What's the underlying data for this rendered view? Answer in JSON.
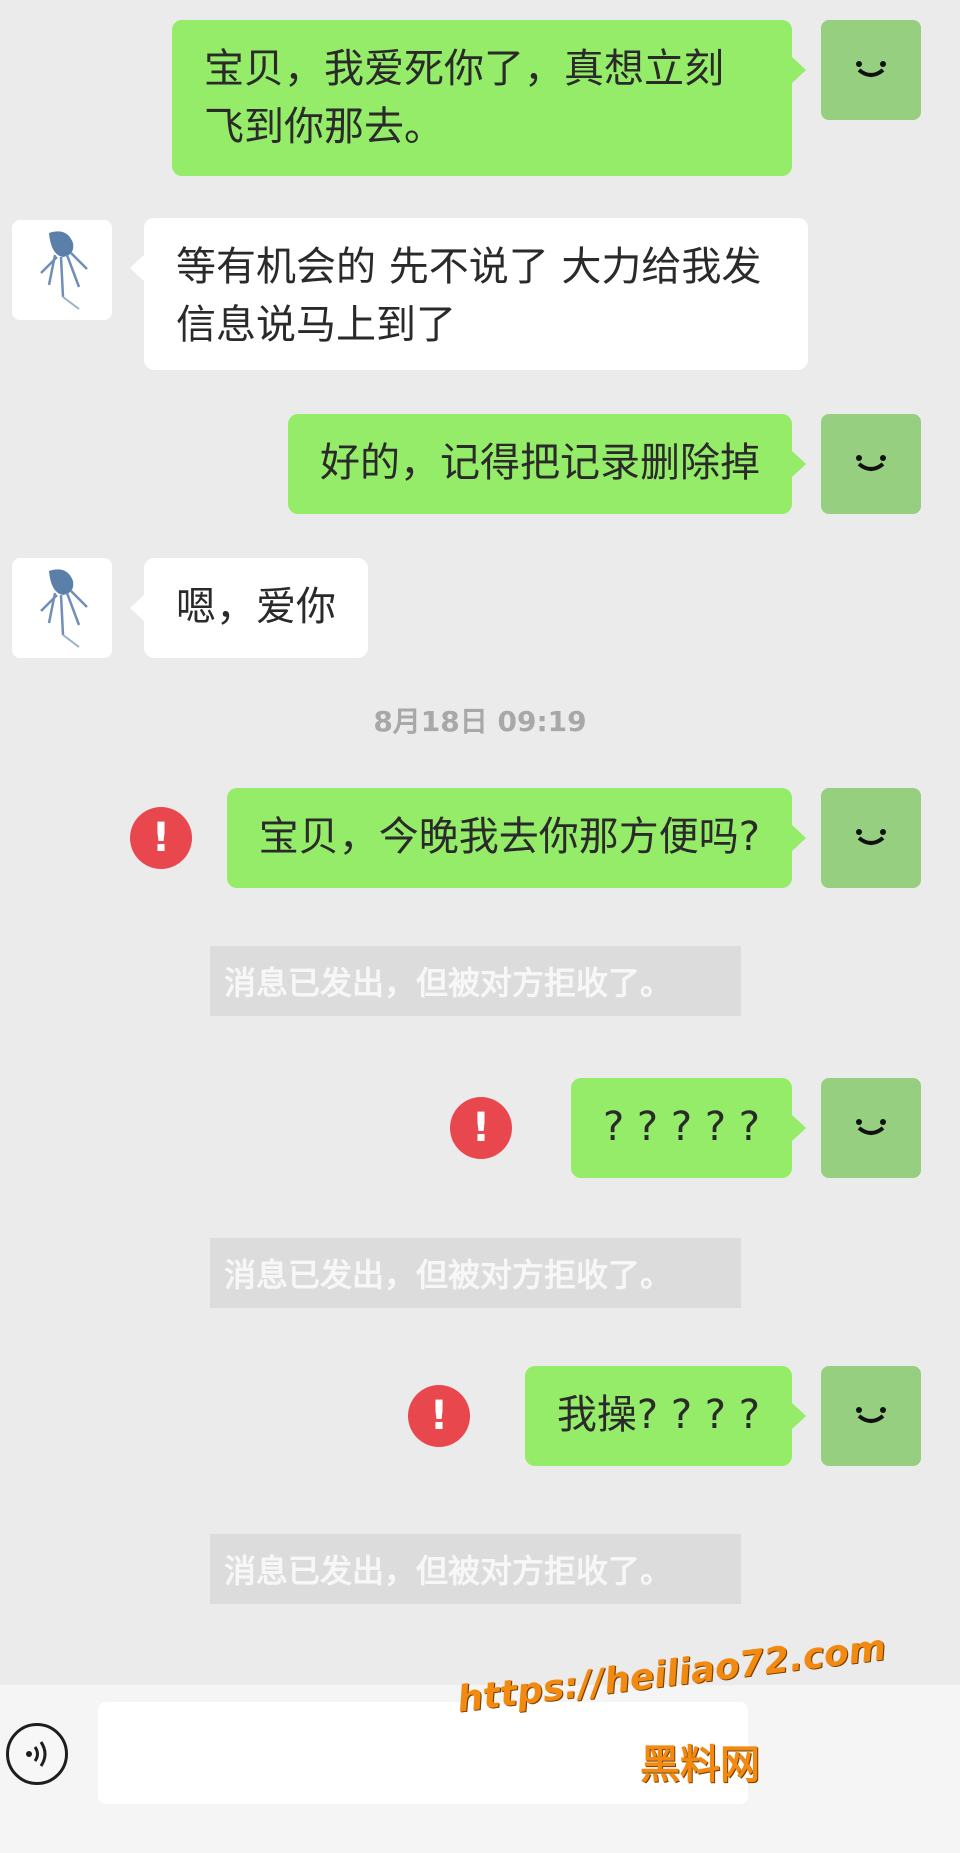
{
  "messages": [
    {
      "side": "me",
      "text": "宝贝，我爱死你了，真想立刻飞到你那去。"
    },
    {
      "side": "them",
      "text": "等有机会的 先不说了 大力给我发信息说马上到了"
    },
    {
      "side": "me",
      "text": "好的，记得把记录删除掉"
    },
    {
      "side": "them",
      "text": "嗯，爱你"
    },
    {
      "side": "me",
      "text": "宝贝，今晚我去你那方便吗?",
      "failed": true
    },
    {
      "side": "me",
      "text": "? ? ? ? ?",
      "failed": true
    },
    {
      "side": "me",
      "text": "我操? ? ? ?",
      "failed": true
    }
  ],
  "timestamp": "8月18日 09:19",
  "error_mark": "!",
  "rejected_notice": "消息已发出，但被对方拒收了。",
  "watermark": {
    "url": "https://heiliao72.com",
    "name": "黑料网"
  },
  "icons": {
    "my_avatar": "smile-face-icon",
    "their_avatar": "jellyfish-avatar-icon",
    "error": "exclamation-icon",
    "voice": "voice-input-icon"
  },
  "colors": {
    "my_bubble": "#95ec69",
    "their_bubble": "#ffffff",
    "background": "#ebebeb",
    "error": "#e8474d"
  }
}
